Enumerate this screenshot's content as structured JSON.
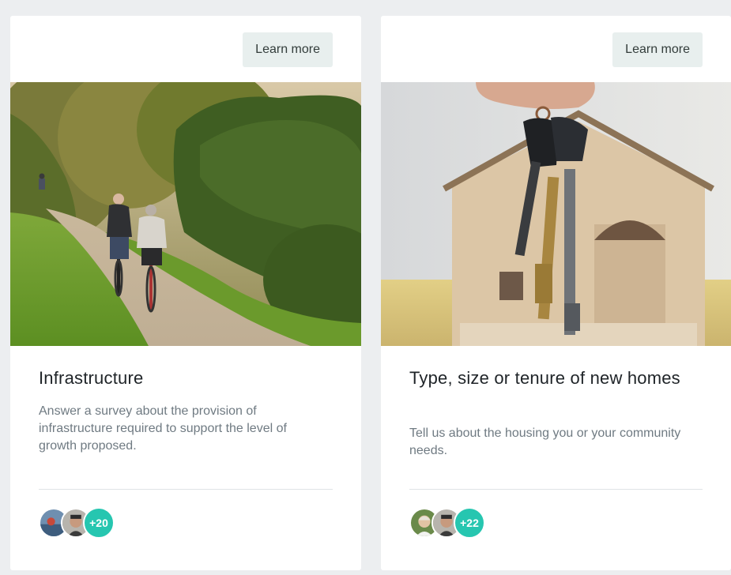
{
  "cards": [
    {
      "learn_more_label": "Learn more",
      "image_subject": "cyclists-on-path-photo",
      "title": "Infrastructure",
      "description": "Answer a survey about the provision of infrastructure required to support the level of growth proposed.",
      "participants_extra": "+20"
    },
    {
      "learn_more_label": "Learn more",
      "image_subject": "house-keys-photo",
      "title": "Type, size or tenure of new homes",
      "description": "Tell us about the housing you or your community needs.",
      "participants_extra": "+22"
    }
  ],
  "colors": {
    "page_bg": "#eceef0",
    "card_bg": "#ffffff",
    "button_bg": "#e8efee",
    "count_badge": "#26c6b0",
    "title_text": "#1f2428",
    "desc_text": "#6f7a82"
  }
}
